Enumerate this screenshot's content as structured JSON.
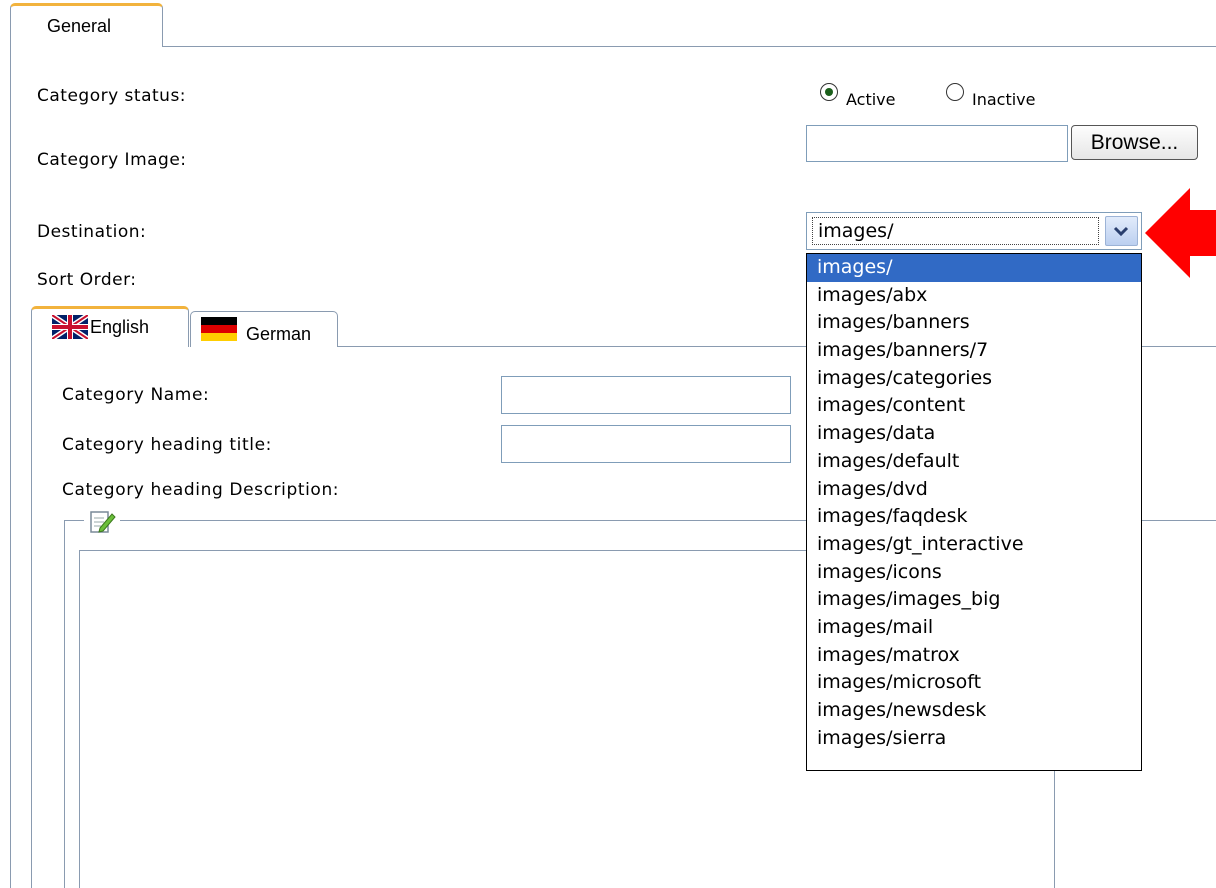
{
  "tabs": {
    "general": "General"
  },
  "form": {
    "status_label": "Category status:",
    "status_options": {
      "active": "Active",
      "inactive": "Inactive",
      "selected": "Active"
    },
    "image_label": "Category Image:",
    "browse_label": "Browse...",
    "destination_label": "Destination:",
    "destination_value": "images/",
    "sort_order_label": "Sort Order:"
  },
  "destination_options": [
    "images/",
    "images/abx",
    "images/banners",
    "images/banners/7",
    "images/categories",
    "images/content",
    "images/data",
    "images/default",
    "images/dvd",
    "images/faqdesk",
    "images/gt_interactive",
    "images/icons",
    "images/images_big",
    "images/mail",
    "images/matrox",
    "images/microsoft",
    "images/newsdesk",
    "images/sierra"
  ],
  "language_tabs": {
    "english": "English",
    "german": "German"
  },
  "lang_form": {
    "name_label": "Category Name:",
    "heading_title_label": "Category heading title:",
    "heading_desc_label": "Category heading Description:"
  },
  "colors": {
    "arrow": "#ff0000",
    "tab_accent": "#f2b33d",
    "select_highlight": "#316ac5"
  },
  "icons": [
    "radio-checked-icon",
    "radio-unchecked-icon",
    "dropdown-chevron-icon",
    "uk-flag-icon",
    "german-flag-icon",
    "edit-note-icon",
    "red-arrow-icon"
  ]
}
